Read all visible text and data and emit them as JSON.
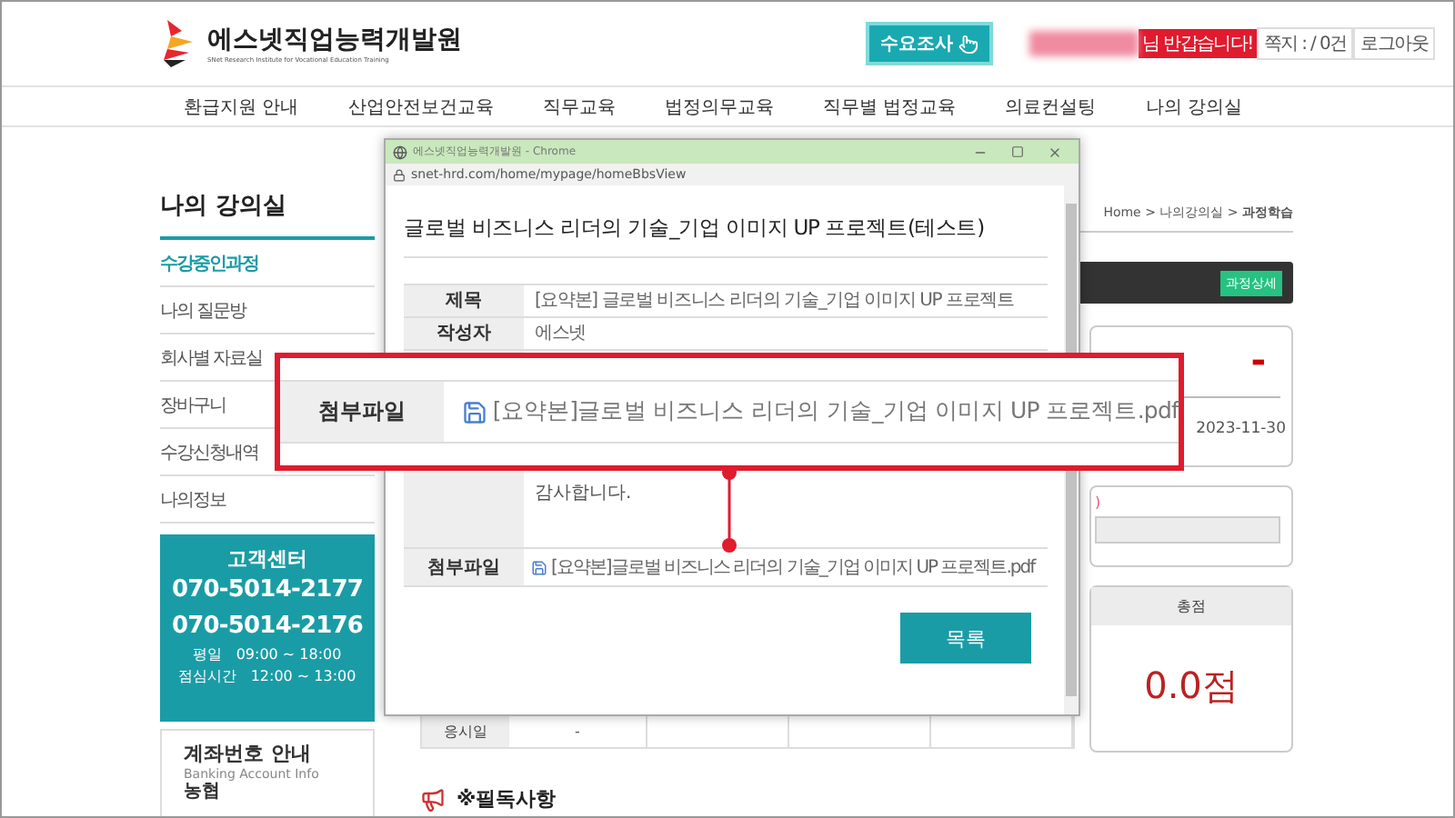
{
  "header": {
    "logo_title": "에스넷직업능력개발원",
    "logo_subtitle": "SNet Research Institute for Vocational Education Training",
    "survey_button": "수요조사",
    "greeting": "님 반갑습니다!",
    "messages": "쪽지 : / 0건",
    "logout": "로그아웃"
  },
  "nav": [
    "환급지원 안내",
    "산업안전보건교육",
    "직무교육",
    "법정의무교육",
    "직무별 법정교육",
    "의료컨설팅",
    "나의 강의실"
  ],
  "sidebar": {
    "title": "나의 강의실",
    "items": [
      {
        "label": "수강중인과정",
        "selected": true
      },
      {
        "label": "나의 질문방",
        "selected": false
      },
      {
        "label": "회사별 자료실",
        "selected": false
      },
      {
        "label": "장바구니",
        "selected": false
      },
      {
        "label": "수강신청내역",
        "selected": false
      },
      {
        "label": "나의정보",
        "selected": false
      }
    ],
    "support": {
      "title": "고객센터",
      "phones": [
        "070-5014-2177",
        "070-5014-2176"
      ],
      "hours": [
        {
          "label": "평일",
          "time": "09:00 ~ 18:00"
        },
        {
          "label": "점심시간",
          "time": "12:00 ~ 13:00"
        }
      ]
    },
    "bank": {
      "title": "계좌번호 안내",
      "subtitle": "Banking Account Info",
      "name": "농협"
    }
  },
  "content": {
    "breadcrumb": "Home > 나의강의실 > **과정학습**",
    "detail_button": "과정상세",
    "period_value": "-",
    "end_date": "2023-11-30",
    "progress_note": ")",
    "progress_bar": {
      "level": 0
    },
    "score_label": "총점",
    "score": "0.0점",
    "exam_label": "응시일",
    "exam_value": "-",
    "notice_title": "※필독사항"
  },
  "popup": {
    "window_title": "에스넷직업능력개발원 - Chrome",
    "url": "snet-hrd.com/home/mypage/homeBbsView",
    "title": "글로벌 비즈니스 리더의 기술_기업 이미지 UP 프로젝트(테스트)",
    "rows": [
      {
        "label": "제목",
        "value": "[요약본] 글로벌 비즈니스 리더의 기술_기업 이미지 UP 프로젝트"
      },
      {
        "label": "작성자",
        "value": "에스넷"
      }
    ],
    "body_text": "감사합니다.",
    "attachment": {
      "label": "첨부파일",
      "file": "[요약본]글로벌 비즈니스 리더의 기술_기업 이미지 UP 프로젝트.pdf"
    },
    "list_button": "목록"
  },
  "callout": {
    "label": "첨부파일",
    "file": "[요약본]글로벌 비즈니스 리더의 기술_기업 이미지 UP 프로젝트.pdf"
  }
}
